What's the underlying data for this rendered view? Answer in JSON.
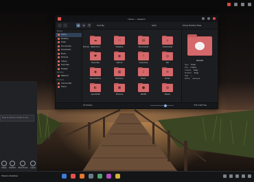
{
  "window": {
    "title": "Home — Dolphin"
  },
  "toolbar": {
    "sort_label": "Sort By",
    "split_label": "Split",
    "places_label": "Show Hidden Files",
    "back_icon": "back-arrow-icon",
    "forward_icon": "forward-arrow-icon"
  },
  "breadcrumb": {
    "home_label": "Home"
  },
  "places": {
    "header1": "Places",
    "items": [
      "Home",
      "Desktop",
      "Trash",
      "Documents",
      "Downloads",
      "Music",
      "Pictures",
      "Videos",
      "Favorites",
      "Flatpak"
    ],
    "header2": "Remote",
    "items2": [
      "Network"
    ],
    "header3": "Devices",
    "items3": [
      "Unmounted",
      "Home"
    ]
  },
  "files": [
    {
      "label": "Nextcloud",
      "glyph": "☁"
    },
    {
      "label": "Desktop",
      "glyph": "▭"
    },
    {
      "label": "Documents",
      "glyph": "▤"
    },
    {
      "label": "Downloads",
      "glyph": "↓"
    },
    {
      "label": "Favorites",
      "glyph": "♥"
    },
    {
      "label": "Github",
      "glyph": "◉"
    },
    {
      "label": "Important",
      "glyph": "!"
    },
    {
      "label": "ISO",
      "glyph": "◎"
    },
    {
      "label": "KeenAddons",
      "glyph": "◆"
    },
    {
      "label": "Macbinry",
      "glyph": "▦"
    },
    {
      "label": "Music",
      "glyph": "♪"
    },
    {
      "label": "Notes",
      "glyph": "≡"
    },
    {
      "label": "openSUSE",
      "glyph": "◐"
    },
    {
      "label": "Pictures",
      "glyph": "▣"
    },
    {
      "label": "Reddit",
      "glyph": "●"
    },
    {
      "label": "Steam",
      "glyph": "◍"
    }
  ],
  "info": {
    "name": "Reddit",
    "rows": [
      {
        "k": "Type:",
        "v": "Folder"
      },
      {
        "k": "Size:",
        "v": "0 items"
      },
      {
        "k": "Created:",
        "v": "Today"
      },
      {
        "k": "Modified:",
        "v": "Today"
      },
      {
        "k": "Tags:",
        "v": "—"
      },
      {
        "k": "Rating:",
        "v": "★★★★★"
      }
    ]
  },
  "status": {
    "left": "16 Folders",
    "right": "535.4 GiB free"
  },
  "leftpanel": {
    "search_placeholder": "Type to search a slider to use",
    "actions": [
      "Sleep",
      "Restart",
      "Shut Down",
      "Leave"
    ]
  },
  "taskbar": {
    "start_label": "Plasma Desktop"
  },
  "colors": {
    "accent": "#d4686a",
    "selection": "#30415a"
  }
}
